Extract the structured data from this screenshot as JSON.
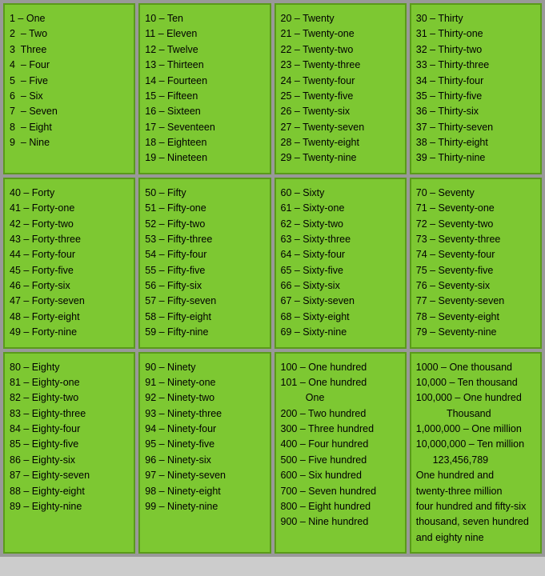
{
  "cells": [
    {
      "id": "cell-1-9",
      "content": "1 – One\n2  – Two\n3  Three\n4  – Four\n5  – Five\n6  – Six\n7  – Seven\n8  – Eight\n9  – Nine"
    },
    {
      "id": "cell-10-19",
      "content": "10 – Ten\n11 – Eleven\n12 – Twelve\n13 – Thirteen\n14 – Fourteen\n15 – Fifteen\n16 – Sixteen\n17 – Seventeen\n18 – Eighteen\n19 – Nineteen"
    },
    {
      "id": "cell-20-29",
      "content": "20 – Twenty\n21 – Twenty-one\n22 – Twenty-two\n23 – Twenty-three\n24 – Twenty-four\n25 – Twenty-five\n26 – Twenty-six\n27 – Twenty-seven\n28 – Twenty-eight\n29 – Twenty-nine"
    },
    {
      "id": "cell-30-39",
      "content": "30 – Thirty\n31 – Thirty-one\n32 – Thirty-two\n33 – Thirty-three\n34 – Thirty-four\n35 – Thirty-five\n36 – Thirty-six\n37 – Thirty-seven\n38 – Thirty-eight\n39 – Thirty-nine"
    },
    {
      "id": "cell-40-49",
      "content": "40 – Forty\n41 – Forty-one\n42 – Forty-two\n43 – Forty-three\n44 – Forty-four\n45 – Forty-five\n46 – Forty-six\n47 – Forty-seven\n48 – Forty-eight\n49 – Forty-nine"
    },
    {
      "id": "cell-50-59",
      "content": "50 – Fifty\n51 – Fifty-one\n52 – Fifty-two\n53 – Fifty-three\n54 – Fifty-four\n55 – Fifty-five\n56 – Fifty-six\n57 – Fifty-seven\n58 – Fifty-eight\n59 – Fifty-nine"
    },
    {
      "id": "cell-60-69",
      "content": "60 – Sixty\n61 – Sixty-one\n62 – Sixty-two\n63 – Sixty-three\n64 – Sixty-four\n65 – Sixty-five\n66 – Sixty-six\n67 – Sixty-seven\n68 – Sixty-eight\n69 – Sixty-nine"
    },
    {
      "id": "cell-70-79",
      "content": "70 – Seventy\n71 – Seventy-one\n72 – Seventy-two\n73 – Seventy-three\n74 – Seventy-four\n75 – Seventy-five\n76 – Seventy-six\n77 – Seventy-seven\n78 – Seventy-eight\n79 – Seventy-nine"
    },
    {
      "id": "cell-80-89",
      "content": "80 – Eighty\n81 – Eighty-one\n82 – Eighty-two\n83 – Eighty-three\n84 – Eighty-four\n85 – Eighty-five\n86 – Eighty-six\n87 – Eighty-seven\n88 – Eighty-eight\n89 – Eighty-nine"
    },
    {
      "id": "cell-90-99",
      "content": "90 – Ninety\n91 – Ninety-one\n92 – Ninety-two\n93 – Ninety-three\n94 – Ninety-four\n95 – Ninety-five\n96 – Ninety-six\n97 – Ninety-seven\n98 – Ninety-eight\n99 – Ninety-nine"
    },
    {
      "id": "cell-100-900",
      "content": "100 – One hundred\n101 – One hundred\n         One\n200 – Two hundred\n300 – Three hundred\n400 – Four hundred\n500 – Five hundred\n600 – Six hundred\n700 – Seven hundred\n800 – Eight hundred\n900 – Nine hundred"
    },
    {
      "id": "cell-1000-plus",
      "content": "1000 – One thousand\n10,000 – Ten thousand\n100,000 – One hundred\n           Thousand\n1,000,000 – One million\n10,000,000 – Ten million\n      123,456,789\nOne hundred and\ntwenty-three million\nfour hundred and fifty-six\nthousand, seven hundred\nand eighty nine"
    }
  ]
}
